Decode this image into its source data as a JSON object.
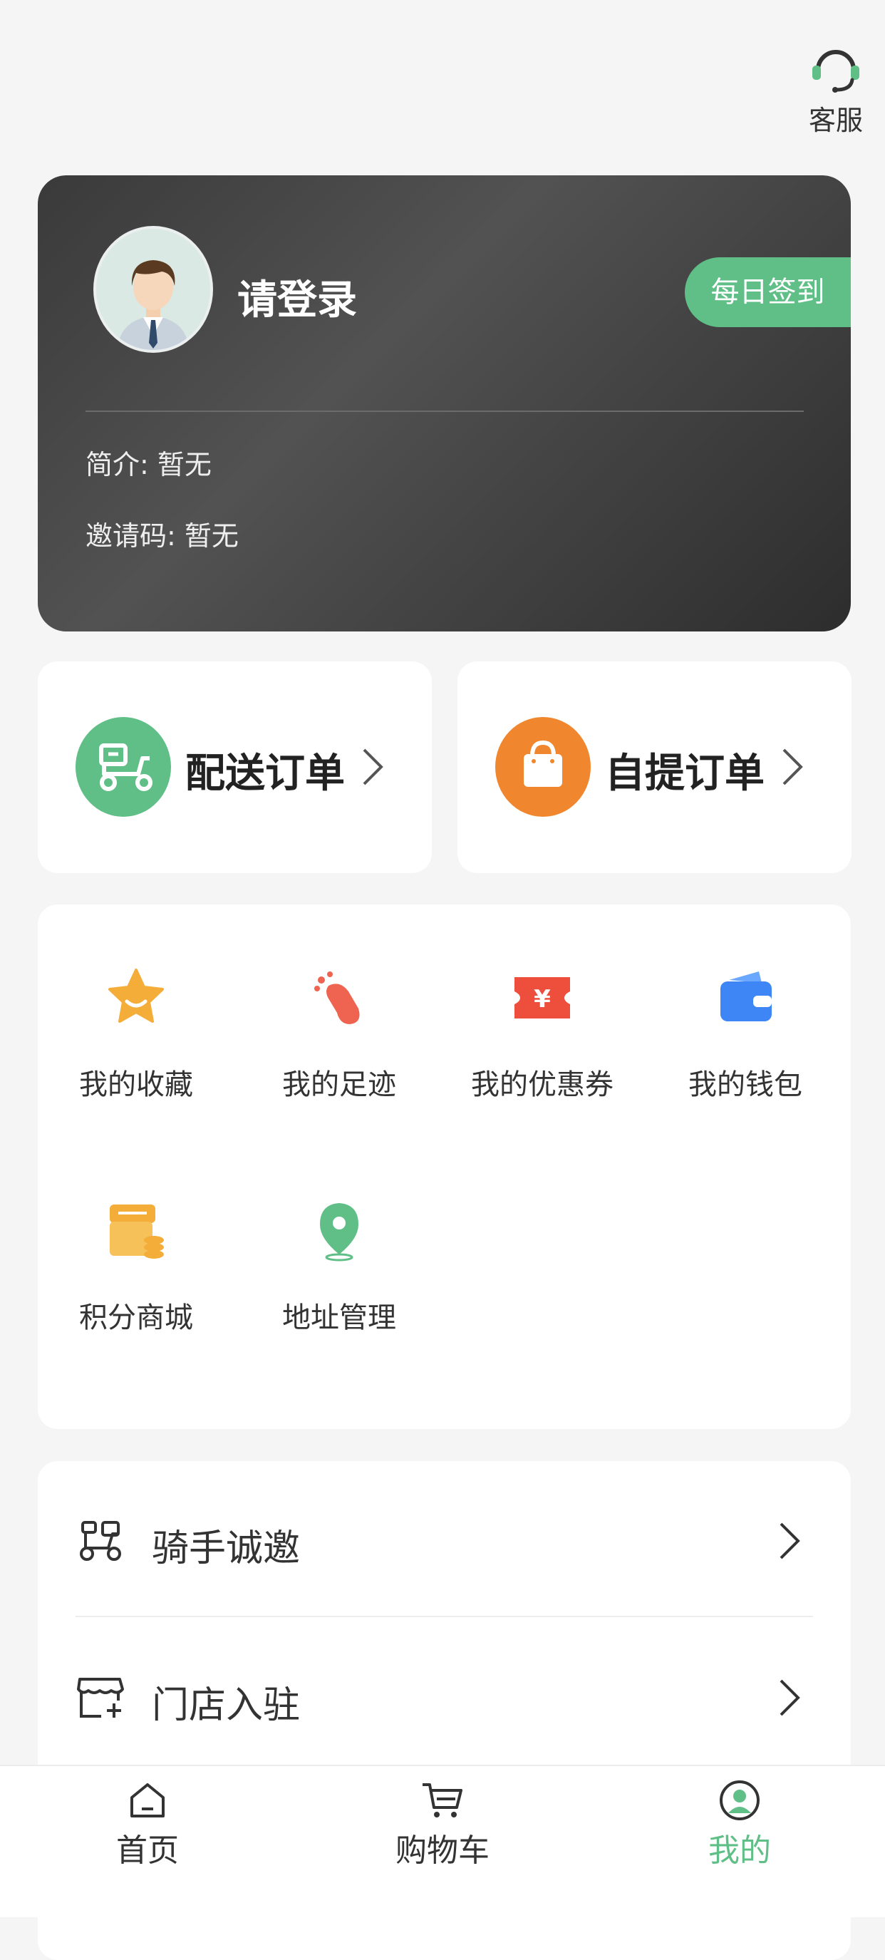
{
  "header": {
    "service_label": "客服"
  },
  "profile": {
    "login_prompt": "请登录",
    "signin_button": "每日签到",
    "intro_label": "简介:",
    "intro_value": "暂无",
    "invite_label": "邀请码:",
    "invite_value": "暂无"
  },
  "orders": {
    "delivery_label": "配送订单",
    "pickup_label": "自提订单"
  },
  "grid": {
    "items": [
      {
        "label": "我的收藏",
        "icon": "star-icon"
      },
      {
        "label": "我的足迹",
        "icon": "footprint-icon"
      },
      {
        "label": "我的优惠券",
        "icon": "coupon-icon"
      },
      {
        "label": "我的钱包",
        "icon": "wallet-icon"
      },
      {
        "label": "积分商城",
        "icon": "points-shop-icon"
      },
      {
        "label": "地址管理",
        "icon": "location-pin-icon"
      }
    ]
  },
  "list": {
    "items": [
      {
        "label": "骑手诚邀",
        "icon": "scooter-icon"
      },
      {
        "label": "门店入驻",
        "icon": "store-add-icon"
      }
    ]
  },
  "tabbar": {
    "tabs": [
      {
        "label": "首页",
        "icon": "home-icon"
      },
      {
        "label": "购物车",
        "icon": "cart-icon"
      },
      {
        "label": "我的",
        "icon": "user-icon"
      }
    ]
  },
  "colors": {
    "accent_green": "#5fbf86",
    "accent_orange": "#f0872e",
    "card_dark": "#3a3a3a"
  }
}
